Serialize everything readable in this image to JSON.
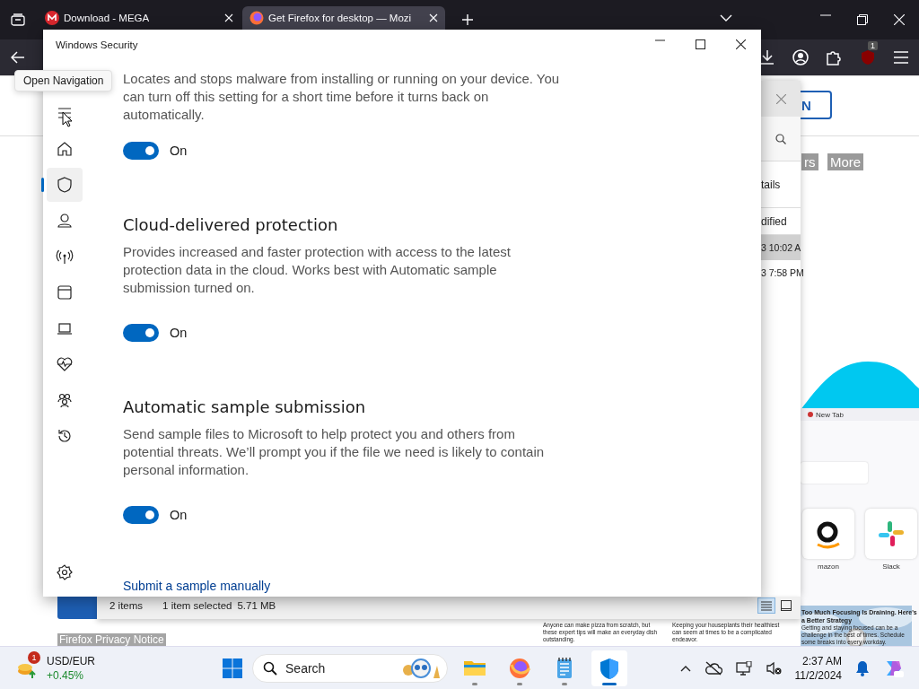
{
  "browser": {
    "tabs": [
      {
        "title": "Download - MEGA",
        "selected": false
      },
      {
        "title": "Get Firefox for desktop — Mozi",
        "selected": true
      }
    ],
    "extension_badge": "1",
    "page": {
      "header_button": "N",
      "highlighted_links": [
        "rs",
        "More"
      ],
      "preview": {
        "tab_title": "New Tab",
        "shortcuts": [
          "mazon",
          "Slack"
        ]
      },
      "articles": [
        {
          "body": "Anyone can make pizza from scratch, but these expert tips will make an everyday dish outstanding."
        },
        {
          "body": "Keeping your houseplants their healthiest can seem at times to be a complicated endeavor."
        },
        {
          "title": "Too Much Focusing Is Draining. Here's a Better Strategy",
          "body": "Getting and staying focused can be a challenge in the best of times. Schedule some breaks into every workday."
        }
      ],
      "privacy_link": "Firefox Privacy Notice"
    }
  },
  "file_explorer": {
    "details_button": "tails",
    "column_header": "dified",
    "rows": [
      {
        "modified": "3 10:02 A",
        "selected": true
      },
      {
        "modified": "3 7:58 PM",
        "selected": false
      }
    ],
    "status": {
      "item_count": "2 items",
      "selection": "1 item selected",
      "size": "5.71 MB"
    },
    "views": [
      {
        "kind": "details",
        "selected": true
      },
      {
        "kind": "tiles",
        "selected": false
      }
    ]
  },
  "security": {
    "title": "Windows Security",
    "tooltip": "Open Navigation",
    "nav": [
      {
        "kind": "menu",
        "selected": false
      },
      {
        "kind": "home",
        "selected": false
      },
      {
        "kind": "shield",
        "selected": true
      },
      {
        "kind": "account",
        "selected": false
      },
      {
        "kind": "network",
        "selected": false
      },
      {
        "kind": "app",
        "selected": false
      },
      {
        "kind": "device",
        "selected": false
      },
      {
        "kind": "health",
        "selected": false
      },
      {
        "kind": "family",
        "selected": false
      },
      {
        "kind": "history",
        "selected": false
      },
      {
        "kind": "settings",
        "selected": false
      }
    ],
    "sections": [
      {
        "description": "Locates and stops malware from installing or running on your device. You can turn off this setting for a short time before it turns back on automatically.",
        "toggle": {
          "on": true,
          "label": "On"
        }
      },
      {
        "heading": "Cloud-delivered protection",
        "description": "Provides increased and faster protection with access to the latest protection data in the cloud. Works best with Automatic sample submission turned on.",
        "toggle": {
          "on": true,
          "label": "On"
        }
      },
      {
        "heading": "Automatic sample submission",
        "description": "Send sample files to Microsoft to help protect you and others from potential threats. We’ll prompt you if the file we need is likely to contain personal information.",
        "toggle": {
          "on": true,
          "label": "On"
        }
      }
    ],
    "link": "Submit a sample manually"
  },
  "taskbar": {
    "widget": {
      "title": "USD/EUR",
      "change": "+0.45%",
      "badge": "1"
    },
    "search": {
      "placeholder": "Search"
    },
    "apps": [
      {
        "kind": "file-explorer",
        "selected": false
      },
      {
        "kind": "firefox",
        "selected": false
      },
      {
        "kind": "notepad",
        "selected": false
      },
      {
        "kind": "defender",
        "selected": true
      }
    ],
    "clock": {
      "time": "2:37 AM",
      "date": "11/2/2024"
    }
  }
}
